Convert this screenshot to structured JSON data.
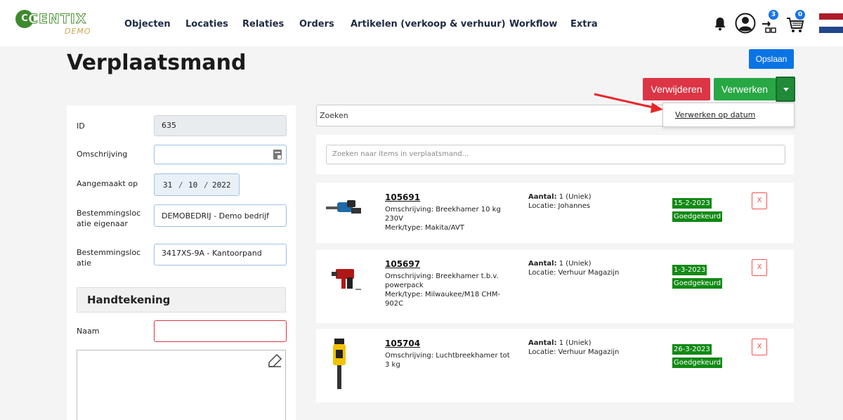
{
  "brand": {
    "logo_text": "CENTIX",
    "sub_label": "DEMO"
  },
  "nav": {
    "items": [
      {
        "label": "Objecten"
      },
      {
        "label": "Locaties"
      },
      {
        "label": "Relaties"
      },
      {
        "label": "Orders"
      },
      {
        "label": "Artikelen (verkoop & verhuur)"
      },
      {
        "label": "Workflow"
      },
      {
        "label": "Extra"
      }
    ],
    "icons": [
      {
        "name": "bell-icon"
      },
      {
        "name": "user-icon"
      },
      {
        "name": "move-basket-icon",
        "badge": "3"
      },
      {
        "name": "cart-icon",
        "badge": "0"
      },
      {
        "name": "flag-nl-icon"
      }
    ]
  },
  "page": {
    "title": "Verplaatsmand"
  },
  "actions": {
    "save_label": "Opslaan",
    "delete_label": "Verwijderen",
    "process_label": "Verwerken",
    "dropdown_item": "Verwerken op datum"
  },
  "form": {
    "id_label": "ID",
    "id_value": "635",
    "description_label": "Omschrijving",
    "description_value": "",
    "created_label": "Aangemaakt op",
    "created_day": "31",
    "created_month": "10",
    "created_year": "2022",
    "dest_owner_label_1": "Bestemmingsloc",
    "dest_owner_label_2": "atie eigenaar",
    "dest_owner_value": "DEMOBEDRIJ - Demo bedrijf",
    "dest_label_1": "Bestemmingsloc",
    "dest_label_2": "atie",
    "dest_value": "3417XS-9A - Kantoorpand",
    "signature_heading": "Handtekening",
    "name_label": "Naam",
    "name_value": ""
  },
  "search": {
    "top_placeholder": "Zoeken",
    "items_placeholder": "Zoeken naar items in verplaatsmand..."
  },
  "items": [
    {
      "number": "105691",
      "desc_1": "Omschrijving: Breekhamer 10 kg",
      "desc_2": "230V",
      "desc_3": "Merk/type: Makita/AVT",
      "desc_4": "",
      "qty_label": "Aantal:",
      "qty_value": "1 (Uniek)",
      "location": "Locatie: Johannes",
      "date": "15-2-2023",
      "status": "Goedgekeurd",
      "remove": "X"
    },
    {
      "number": "105697",
      "desc_1": "Omschrijving: Breekhamer t.b.v.",
      "desc_2": "powerpack",
      "desc_3": "Merk/type: Milwaukee/M18 CHM-",
      "desc_4": "902C",
      "qty_label": "Aantal:",
      "qty_value": "1 (Uniek)",
      "location": "Locatie: Verhuur Magazijn",
      "date": "1-3-2023",
      "status": "Goedgekeurd",
      "remove": "X"
    },
    {
      "number": "105704",
      "desc_1": "Omschrijving: Luchtbreekhamer tot",
      "desc_2": "3 kg",
      "desc_3": "",
      "desc_4": "",
      "qty_label": "Aantal:",
      "qty_value": "1 (Uniek)",
      "location": "Locatie: Verhuur Magazijn",
      "date": "26-3-2023",
      "status": "Goedgekeurd",
      "remove": "X"
    }
  ],
  "colors": {
    "primary": "#0b74e5",
    "danger": "#dc3545",
    "success": "#28a745",
    "status_green": "#118a14",
    "annotation_arrow": "#e8262a"
  }
}
